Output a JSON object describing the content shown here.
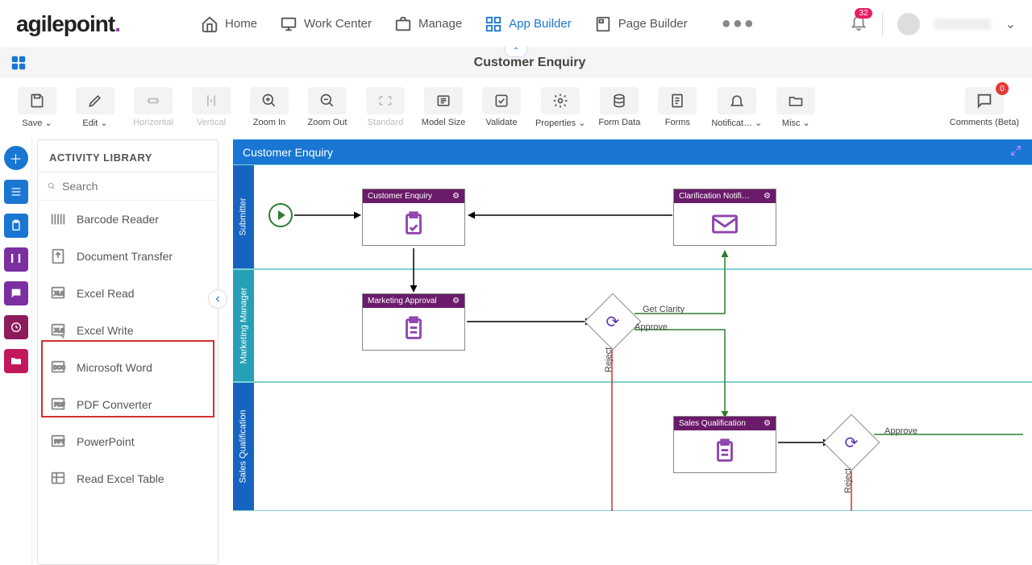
{
  "nav": {
    "logo": "agilepoint",
    "items": [
      {
        "label": "Home"
      },
      {
        "label": "Work Center"
      },
      {
        "label": "Manage"
      },
      {
        "label": "App Builder"
      },
      {
        "label": "Page Builder"
      }
    ],
    "notification_count": "32"
  },
  "title": "Customer Enquiry",
  "toolbar": {
    "save": "Save",
    "edit": "Edit",
    "horizontal": "Horizontal",
    "vertical": "Vertical",
    "zoomin": "Zoom In",
    "zoomout": "Zoom Out",
    "standard": "Standard",
    "modelsize": "Model Size",
    "validate": "Validate",
    "properties": "Properties",
    "formdata": "Form Data",
    "forms": "Forms",
    "notifications": "Notificat…",
    "misc": "Misc",
    "comments": "Comments (Beta)",
    "comments_badge": "0"
  },
  "sidebar": {
    "header": "ACTIVITY LIBRARY",
    "search_placeholder": "Search",
    "items": [
      {
        "label": "Barcode Reader"
      },
      {
        "label": "Document Transfer"
      },
      {
        "label": "Excel Read"
      },
      {
        "label": "Excel Write"
      },
      {
        "label": "Microsoft Word"
      },
      {
        "label": "PDF Converter"
      },
      {
        "label": "PowerPoint"
      },
      {
        "label": "Read Excel Table"
      }
    ]
  },
  "canvas": {
    "header": "Customer Enquiry",
    "lanes": [
      {
        "label": "Submitter"
      },
      {
        "label": "Marketing Manager"
      },
      {
        "label": "Sales Qualification"
      }
    ],
    "activities": {
      "customer_enquiry": "Customer Enquiry",
      "clarification": "Clarification Notifi…",
      "marketing_approval": "Marketing Approval",
      "sales_qualification": "Sales Qualification"
    },
    "edges": {
      "get_clarity": "Get Clarity",
      "approve": "Approve",
      "reject": "Reject",
      "approve2": "Approve",
      "reject2": "Reject"
    }
  }
}
